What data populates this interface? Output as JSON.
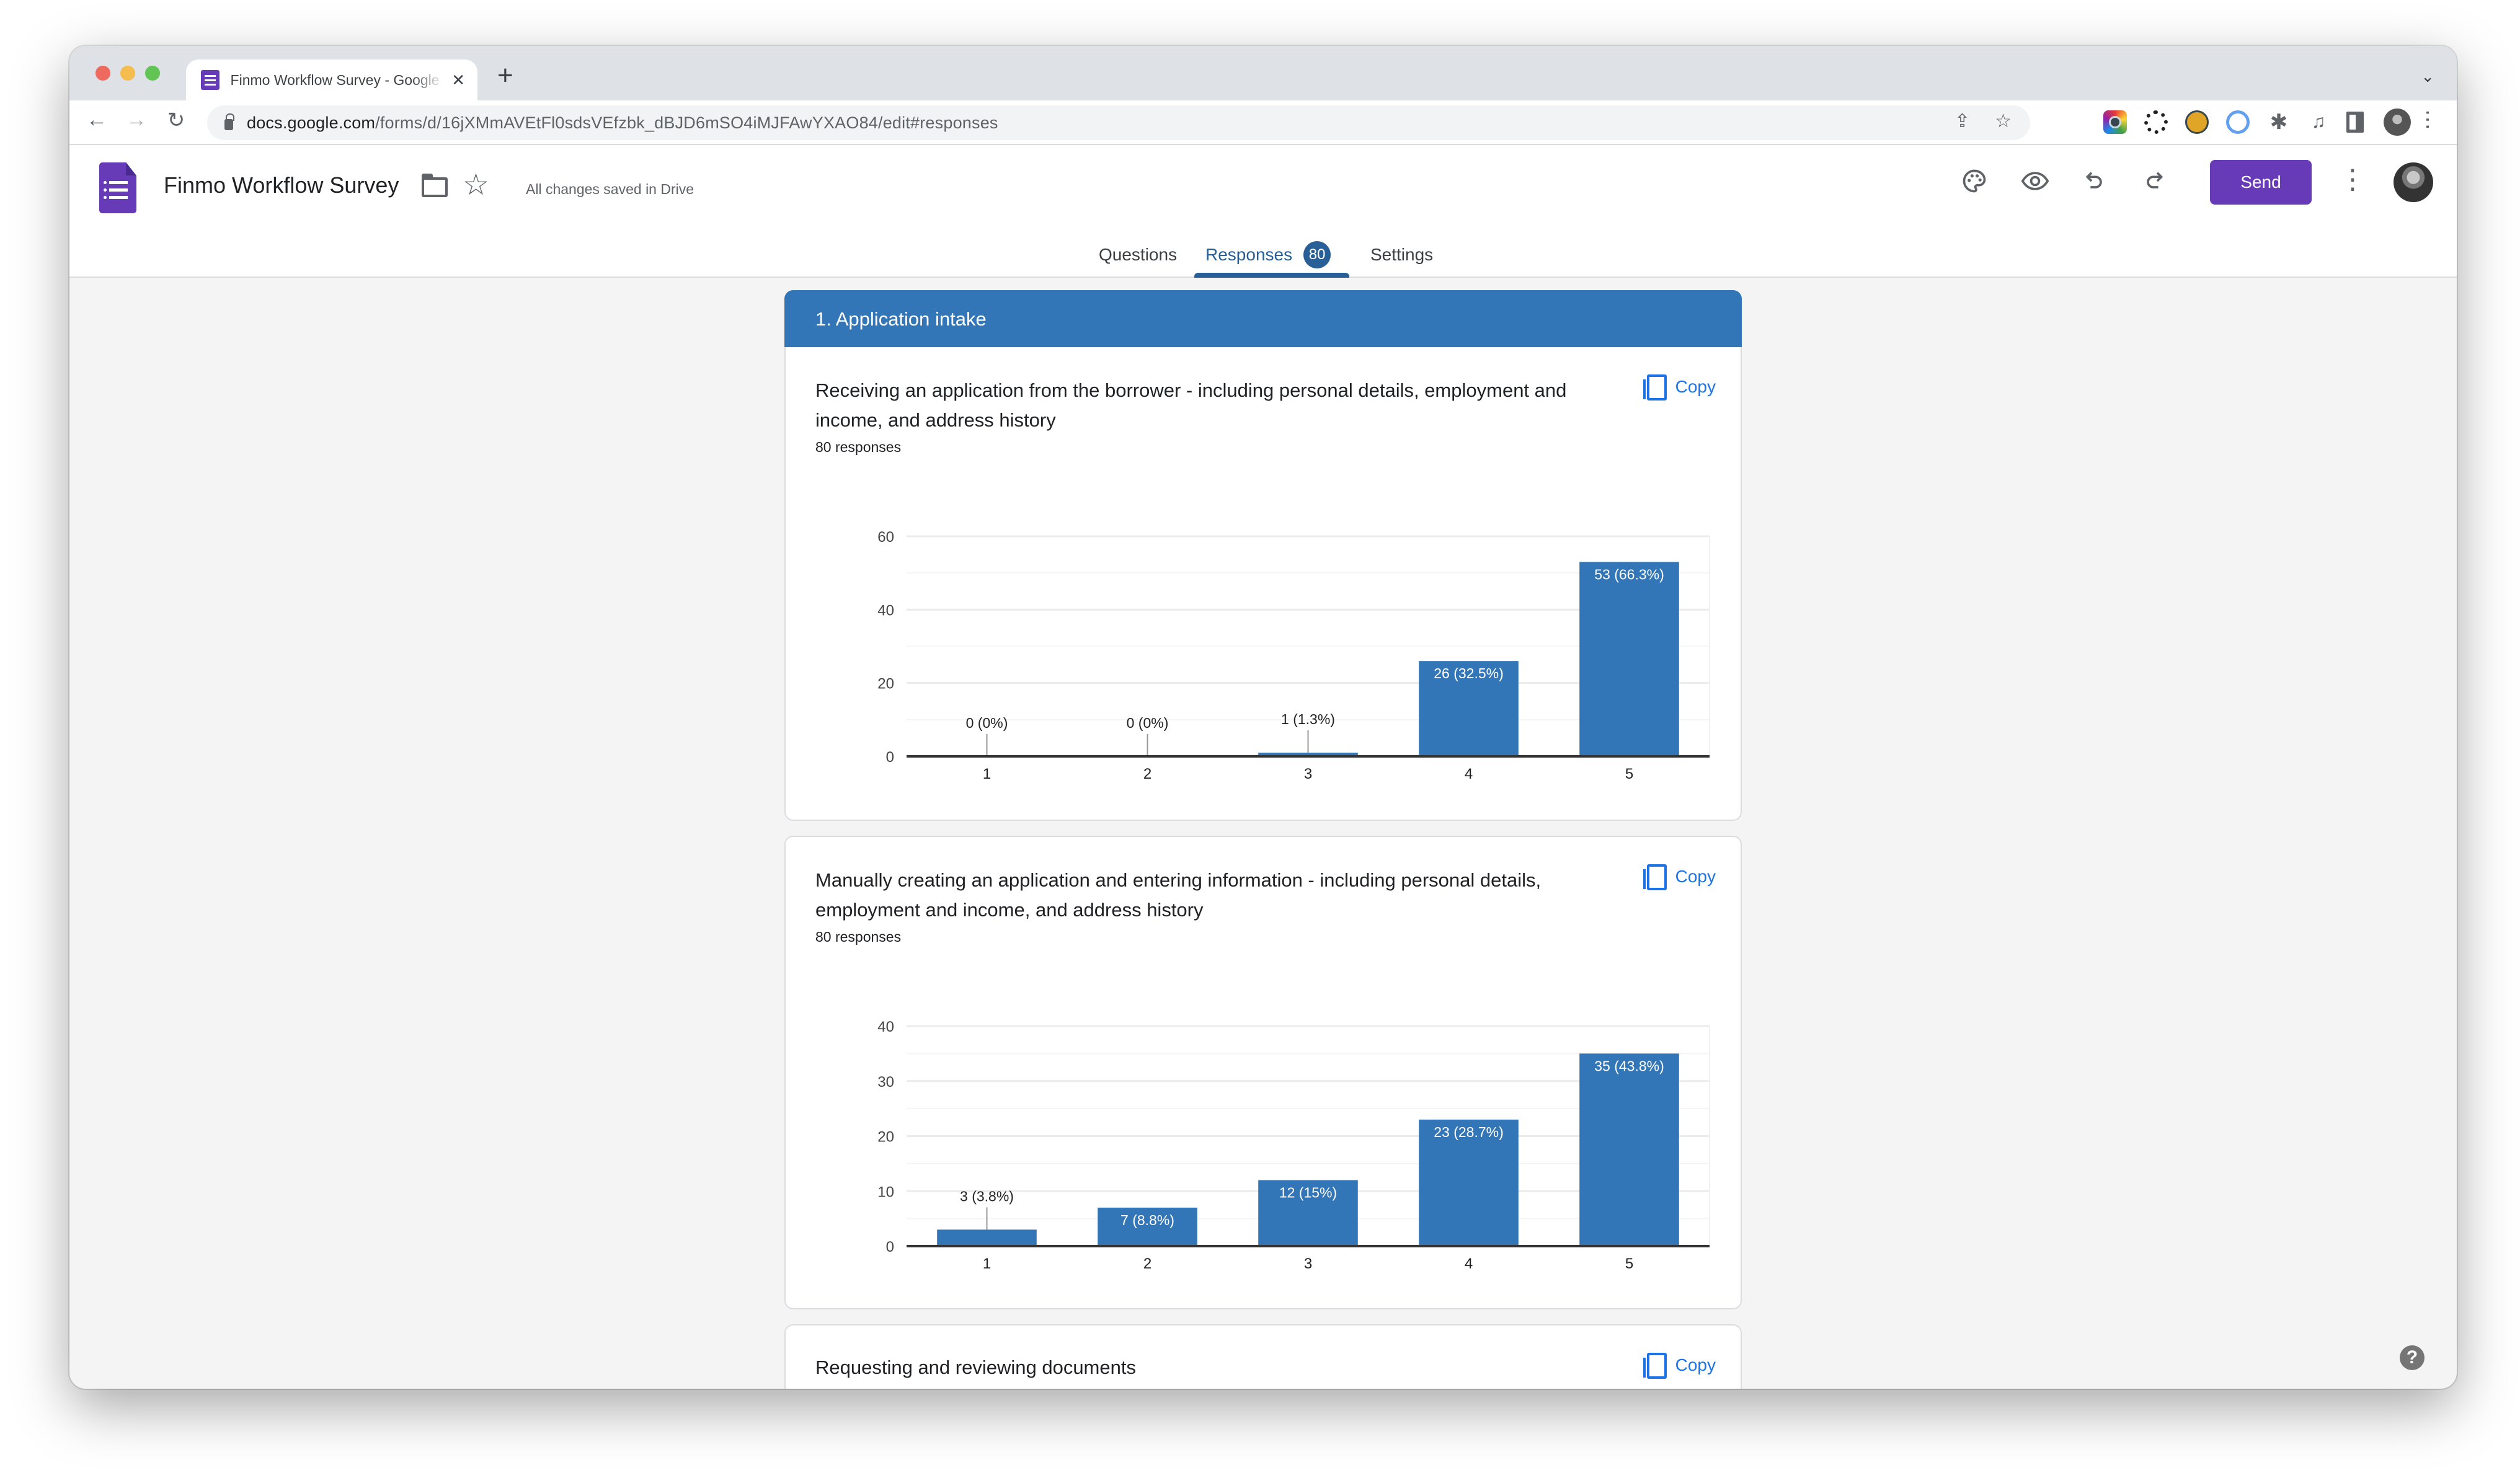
{
  "browser": {
    "tab_title": "Finmo Workflow Survey - Google Forms",
    "tab_close": "✕",
    "new_tab": "+",
    "url_domain": "docs.google.com",
    "url_path": "/forms/d/16jXMmAVEtFl0sdsVEfzbk_dBJD6mSO4iMJFAwYXAO84/edit#responses",
    "share_icon": "⇪",
    "bookmark_icon": "☆",
    "back_icon": "←",
    "forward_icon": "→",
    "reload_icon": "↻",
    "tab_list_icon": "⌄",
    "menu_icon": "⋯",
    "extensions_icon": "✱",
    "media_icon": "♫"
  },
  "app": {
    "form_title": "Finmo Workflow Survey",
    "save_status": "All changes saved in Drive",
    "star_icon": "☆",
    "palette_icon": "🎨",
    "preview_icon": "◉",
    "undo_icon": "↶",
    "redo_icon": "↷",
    "send_label": "Send",
    "more_icon": "⋮",
    "brand_color": "#673ab7",
    "accent_color": "#275f96"
  },
  "tabs": [
    {
      "label": "Questions",
      "active": false
    },
    {
      "label": "Responses",
      "active": true,
      "badge": "80"
    },
    {
      "label": "Settings",
      "active": false
    }
  ],
  "section": {
    "title": "1. Application intake",
    "color": "#3276b8"
  },
  "questions": [
    {
      "text": "Receiving an application from the borrower - including personal details, employment and income, and address history",
      "response_count": "80 responses",
      "copy_label": "Copy"
    },
    {
      "text": "Manually creating an application and entering information - including personal details, employment and income, and address history",
      "response_count": "80 responses",
      "copy_label": "Copy"
    },
    {
      "text": "Requesting and reviewing documents",
      "copy_label": "Copy"
    }
  ],
  "chart_data": [
    {
      "type": "bar",
      "title": "Receiving an application from the borrower - including personal details, employment and income, and address history",
      "categories": [
        "1",
        "2",
        "3",
        "4",
        "5"
      ],
      "values": [
        0,
        0,
        1,
        26,
        53
      ],
      "labels": [
        "0 (0%)",
        "0 (0%)",
        "1 (1.3%)",
        "26 (32.5%)",
        "53 (66.3%)"
      ],
      "yticks": [
        0,
        20,
        40,
        60
      ],
      "ylim": [
        0,
        60
      ],
      "xlabel": "",
      "ylabel": "",
      "grid": true,
      "color": "#3276b8"
    },
    {
      "type": "bar",
      "title": "Manually creating an application and entering information - including personal details, employment and income, and address history",
      "categories": [
        "1",
        "2",
        "3",
        "4",
        "5"
      ],
      "values": [
        3,
        7,
        12,
        23,
        35
      ],
      "labels": [
        "3 (3.8%)",
        "7 (8.8%)",
        "12 (15%)",
        "23 (28.7%)",
        "35 (43.8%)"
      ],
      "yticks": [
        0,
        10,
        20,
        30,
        40
      ],
      "ylim": [
        0,
        40
      ],
      "xlabel": "",
      "ylabel": "",
      "grid": true,
      "color": "#3276b8"
    }
  ],
  "help_icon": "?"
}
